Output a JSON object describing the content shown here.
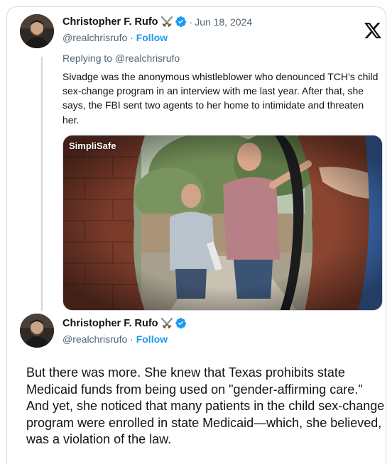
{
  "tweet1": {
    "display_name": "Christopher F. Rufo",
    "handle": "@realchrisrufo",
    "follow_label": "Follow",
    "separator": "·",
    "date": "Jun 18, 2024",
    "reply_prefix": "Replying to ",
    "reply_handle": "@realchrisrufo",
    "text": "Sivadge was the anonymous whistleblower who denounced TCH's child sex-change program in an interview with me last year. After that, she says, the FBI sent two agents to her home to intimidate and threaten her.",
    "media": {
      "brand_label": "SimpliSafe",
      "icon": "doorbell-camera-video"
    }
  },
  "tweet2": {
    "display_name": "Christopher F. Rufo",
    "handle": "@realchrisrufo",
    "follow_label": "Follow",
    "separator": "·",
    "text": "But there was more. She knew that Texas prohibits state Medicaid funds from being used on \"gender-affirming care.\" And yet, she noticed that many patients in the child sex-change program were enrolled in state Medicaid—which, she believed, was a violation of the law."
  },
  "icons": {
    "badge": "crossed-swords-icon",
    "verified": "verified-badge-icon",
    "platform": "x-logo-icon"
  },
  "colors": {
    "link_blue": "#1d9bf0",
    "muted_text": "#536471",
    "border": "#cfd9de",
    "text": "#0f1419"
  }
}
